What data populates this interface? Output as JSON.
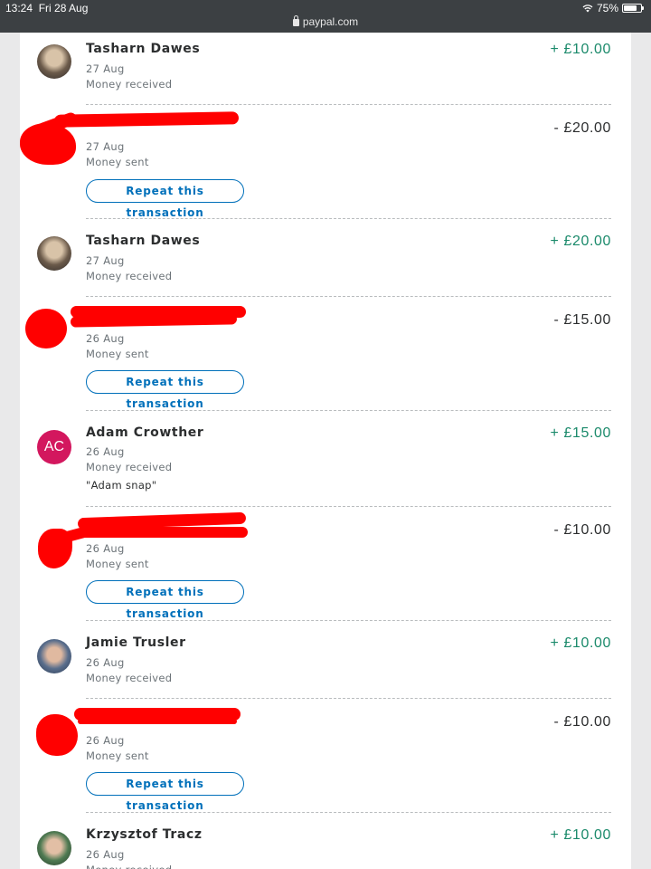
{
  "status": {
    "time": "13:24",
    "date": "Fri 28 Aug",
    "battery": "75%",
    "battery_level": 0.75,
    "url": "paypal.com"
  },
  "colors": {
    "received": "#1b8a6b",
    "link": "#0070ba",
    "redaction": "#ff0000"
  },
  "repeat_label": "Repeat this transaction",
  "transactions": [
    {
      "name": "Tasharn Dawes",
      "date": "27 Aug",
      "type": "Money received",
      "amount": "+ £10.00"
    },
    {
      "name": "",
      "date": "27 Aug",
      "type": "Money sent",
      "amount": "- £20.00"
    },
    {
      "name": "Tasharn Dawes",
      "date": "27 Aug",
      "type": "Money received",
      "amount": "+ £20.00"
    },
    {
      "name": "",
      "date": "26 Aug",
      "type": "Money sent",
      "amount": "- £15.00"
    },
    {
      "name": "Adam Crowther",
      "initials": "AC",
      "date": "26 Aug",
      "type": "Money received",
      "note": "\"Adam snap\"",
      "amount": "+ £15.00"
    },
    {
      "name": "",
      "date": "26 Aug",
      "type": "Money sent",
      "amount": "- £10.00"
    },
    {
      "name": "Jamie Trusler",
      "date": "26 Aug",
      "type": "Money received",
      "amount": "+ £10.00"
    },
    {
      "name": "",
      "date": "26 Aug",
      "type": "Money sent",
      "amount": "- £10.00"
    },
    {
      "name": "Krzysztof Tracz",
      "date": "26 Aug",
      "type": "Money received",
      "amount": "+ £10.00"
    }
  ]
}
